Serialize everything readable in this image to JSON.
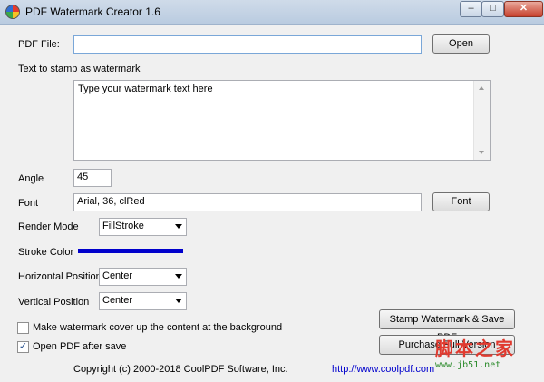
{
  "window": {
    "title": "PDF Watermark Creator  1.6",
    "min": "–",
    "max": "□",
    "close": "✕"
  },
  "pdf_file": {
    "label": "PDF File:",
    "value": "",
    "open_button": "Open"
  },
  "watermark_text": {
    "label": "Text to stamp as watermark",
    "value": "Type your watermark text here"
  },
  "angle": {
    "label": "Angle",
    "value": "45"
  },
  "font": {
    "label": "Font",
    "value": "Arial, 36, clRed",
    "button": "Font"
  },
  "render_mode": {
    "label": "Render Mode",
    "value": "FillStroke"
  },
  "stroke_color": {
    "label": "Stroke Color",
    "color": "#0000cc"
  },
  "horizontal_position": {
    "label": "Horizontal Position",
    "value": "Center"
  },
  "vertical_position": {
    "label": "Vertical Position",
    "value": "Center"
  },
  "cover_content": {
    "label": "Make watermark cover up the content at the background",
    "checked": false
  },
  "open_after_save": {
    "label": "Open PDF after save",
    "checked": true
  },
  "stamp_button": "Stamp Watermark & Save PDF",
  "purchase_button": "Purchase Full Version",
  "footer": {
    "copyright": "Copyright (c) 2000-2018 CoolPDF Software, Inc.",
    "url": "http://www.coolpdf.com"
  },
  "overlay_watermark": {
    "main": "脚本之家",
    "sub": "www.jb51.net"
  }
}
